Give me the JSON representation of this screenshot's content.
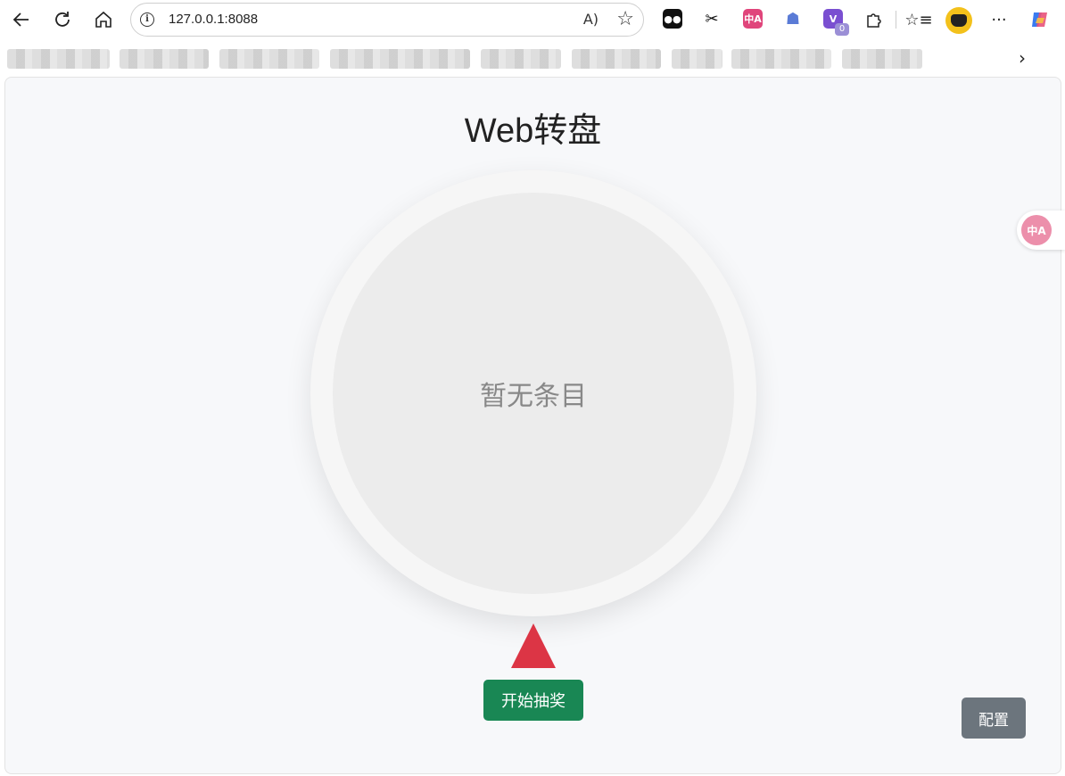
{
  "browser": {
    "url": "127.0.0.1:8088",
    "nav_icons": [
      "back-icon",
      "refresh-icon",
      "home-icon"
    ],
    "extensions": [
      {
        "name": "tampermonkey-icon",
        "color": "#111111",
        "glyph": "●●"
      },
      {
        "name": "scissors-icon",
        "color": "#111111",
        "glyph": "✂"
      },
      {
        "name": "translate-ext-icon",
        "color": "#e0457b",
        "glyph": "中A"
      },
      {
        "name": "agent-ext-icon",
        "color": "#5a7bd6",
        "glyph": "☗"
      },
      {
        "name": "v-ext-icon",
        "color": "#7a4fd1",
        "glyph": "V"
      }
    ],
    "extension_badge": "0",
    "more_menu": "···"
  },
  "page": {
    "title": "Web转盘",
    "wheel_empty_text": "暂无条目",
    "start_button": "开始抽奖",
    "config_button": "配置",
    "translate_float_label": "中A"
  },
  "colors": {
    "pointer": "#dc3545",
    "start_button_bg": "#198754",
    "config_button_bg": "#6c757d",
    "page_bg": "#f7f8fa"
  }
}
